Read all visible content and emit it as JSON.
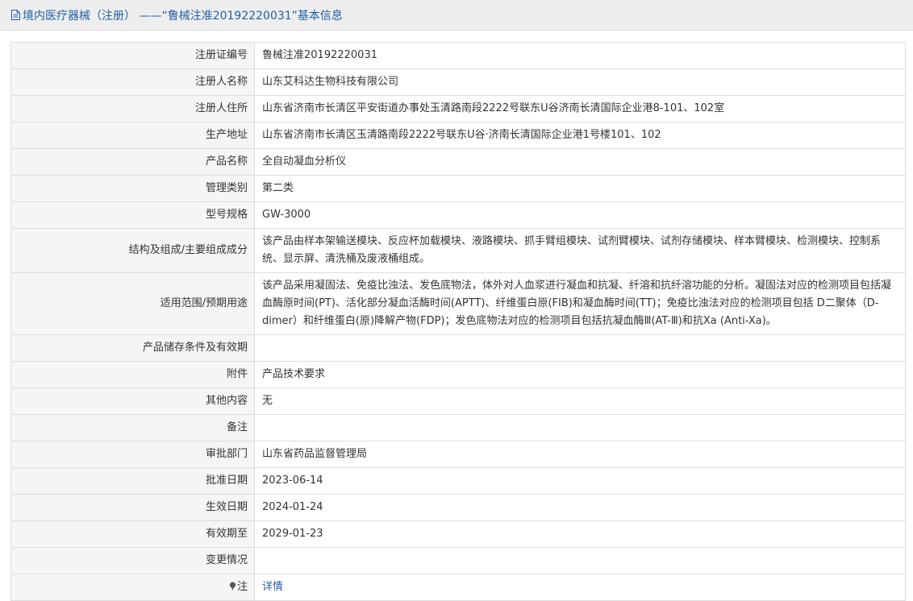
{
  "header": {
    "icon": "document-icon",
    "title": "境内医疗器械（注册） ——“鲁械注准20192220031”基本信息"
  },
  "colors": {
    "link": "#1f5fa8",
    "label_bg": "#f5f5f5",
    "border": "#dddddd"
  },
  "rows": [
    {
      "label": "注册证编号",
      "value": "鲁械注准20192220031"
    },
    {
      "label": "注册人名称",
      "value": "山东艾科达生物科技有限公司"
    },
    {
      "label": "注册人住所",
      "value": "山东省济南市长清区平安街道办事处玉清路南段2222号联东U谷济南长清国际企业港8-101、102室"
    },
    {
      "label": "生产地址",
      "value": "山东省济南市长清区玉清路南段2222号联东U谷·济南长清国际企业港1号楼101、102"
    },
    {
      "label": "产品名称",
      "value": "全自动凝血分析仪"
    },
    {
      "label": "管理类别",
      "value": "第二类"
    },
    {
      "label": "型号规格",
      "value": "GW-3000"
    },
    {
      "label": "结构及组成/主要组成成分",
      "value": "该产品由样本架输送模块、反应杯加载模块、液路模块、抓手臂组模块、试剂臂模块、试剂存储模块、样本臂模块、检测模块、控制系统、显示屏、清洗桶及废液桶组成。"
    },
    {
      "label": "适用范围/预期用途",
      "value": "该产品采用凝固法、免疫比浊法、发色底物法，体外对人血浆进行凝血和抗凝、纤溶和抗纤溶功能的分析。凝固法对应的检测项目包括凝血酶原时间(PT)、活化部分凝血活酶时间(APTT)、纤维蛋白原(FIB)和凝血酶时间(TT)；免疫比浊法对应的检测项目包括 D二聚体（D-dimer）和纤维蛋白(原)降解产物(FDP)；发色底物法对应的检测项目包括抗凝血酶Ⅲ(AT-Ⅲ)和抗Xa (Anti-Xa)。"
    },
    {
      "label": "产品储存条件及有效期",
      "value": ""
    },
    {
      "label": "附件",
      "value": "产品技术要求"
    },
    {
      "label": "其他内容",
      "value": "无"
    },
    {
      "label": "备注",
      "value": ""
    },
    {
      "label": "审批部门",
      "value": "山东省药品监督管理局"
    },
    {
      "label": "批准日期",
      "value": "2023-06-14"
    },
    {
      "label": "生效日期",
      "value": "2024-01-24"
    },
    {
      "label": "有效期至",
      "value": "2029-01-23"
    },
    {
      "label": "变更情况",
      "value": ""
    }
  ],
  "note_row": {
    "icon": "pin-icon",
    "label": "注",
    "link_text": "详情"
  }
}
